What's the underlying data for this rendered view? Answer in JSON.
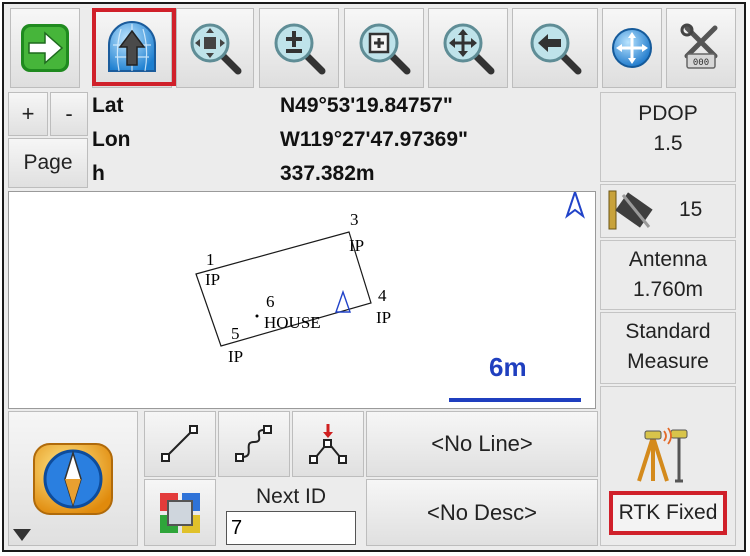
{
  "toolbar": {
    "buttons": [
      {
        "id": "back",
        "icon": "green-arrow-icon"
      },
      {
        "id": "orientation",
        "icon": "north-up-globe-icon",
        "selected": true
      },
      {
        "id": "zoom-fit",
        "icon": "zoom-extents-icon"
      },
      {
        "id": "zoom-in",
        "icon": "zoom-in-icon"
      },
      {
        "id": "zoom-window",
        "icon": "zoom-window-icon"
      },
      {
        "id": "pan",
        "icon": "pan-icon"
      },
      {
        "id": "zoom-previous",
        "icon": "zoom-previous-icon"
      },
      {
        "id": "globe",
        "icon": "globe-icon"
      },
      {
        "id": "tools",
        "icon": "tools-icon"
      }
    ]
  },
  "zoom": {
    "plus": "+",
    "minus": "-"
  },
  "page_label": "Page",
  "coords": {
    "lat_label": "Lat",
    "lat_value": "N49°53'19.84757\"",
    "lon_label": "Lon",
    "lon_value": "W119°27'47.97369\"",
    "h_label": "h",
    "h_value": "337.382m"
  },
  "right_panel": {
    "pdop_label": "PDOP",
    "pdop_value": "1.5",
    "satellites": "15",
    "antenna_label": "Antenna",
    "antenna_value": "1.760m",
    "mode_line1": "Standard",
    "mode_line2": "Measure",
    "status": "RTK Fixed"
  },
  "map": {
    "points": [
      {
        "num": "1",
        "code": "IP"
      },
      {
        "num": "3",
        "code": "IP"
      },
      {
        "num": "4",
        "code": "IP"
      },
      {
        "num": "5",
        "code": "IP"
      },
      {
        "num": "6",
        "code": "HOUSE"
      }
    ],
    "scale": "6m"
  },
  "bottom": {
    "next_id_label": "Next ID",
    "next_id_value": "7",
    "line": "<No Line>",
    "desc": "<No Desc>"
  },
  "colors": {
    "highlight": "#d0202a",
    "scale_bar": "#1f3fbf",
    "north_arrow": "#2143c9"
  }
}
